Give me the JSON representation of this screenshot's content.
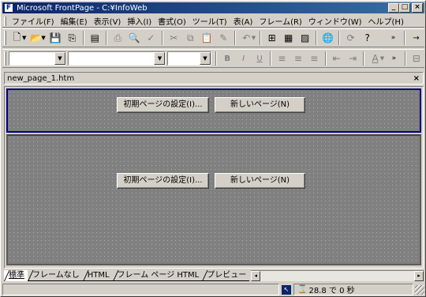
{
  "window": {
    "title": "Microsoft FrontPage - C:¥InfoWeb",
    "minimize": "_",
    "maximize": "□",
    "close": "×"
  },
  "menu": [
    "ファイル(F)",
    "編集(E)",
    "表示(V)",
    "挿入(I)",
    "書式(O)",
    "ツール(T)",
    "表(A)",
    "フレーム(R)",
    "ウィンドウ(W)",
    "ヘルプ(H)"
  ],
  "toolbar_standard": {
    "icons": [
      "new-page-icon",
      "open-icon",
      "save-icon",
      "publish-icon",
      "folder-list-icon",
      "print-icon",
      "print-preview-icon",
      "spelling-icon",
      "cut-icon",
      "copy-icon",
      "paste-icon",
      "format-painter-icon",
      "undo-icon",
      "insert-component-icon",
      "insert-table-icon",
      "insert-picture-icon",
      "hyperlink-icon",
      "refresh-icon",
      "help-icon",
      "more-icon"
    ]
  },
  "toolbar_format": {
    "style_value": "",
    "font_value": "",
    "size_value": "",
    "bold": "B",
    "italic": "I",
    "underline": "U"
  },
  "document": {
    "tab_name": "new_page_1.htm",
    "close": "×"
  },
  "frames": {
    "top": {
      "set_initial_page": "初期ページの設定(I)...",
      "new_page": "新しいページ(N)"
    },
    "bottom": {
      "set_initial_page": "初期ページの設定(I)...",
      "new_page": "新しいページ(N)"
    }
  },
  "view_tabs": [
    "標準",
    "フレームなし",
    "HTML",
    "フレーム ページ HTML",
    "プレビュー"
  ],
  "status": {
    "time_text": "28.8 で 0 秒"
  }
}
